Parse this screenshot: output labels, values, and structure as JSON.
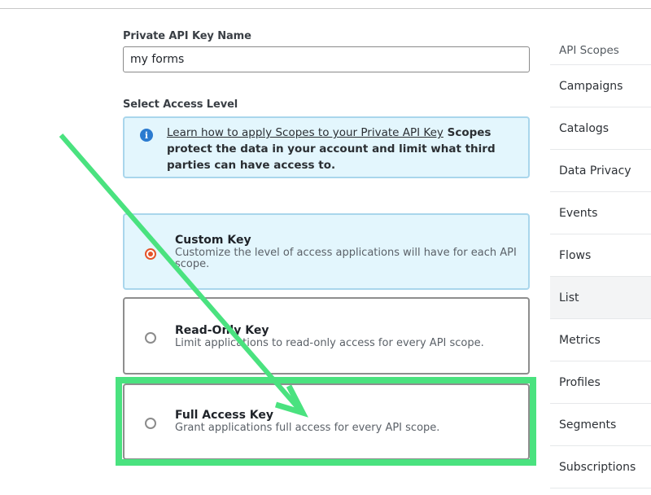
{
  "form": {
    "key_name_label": "Private API Key Name",
    "key_name_value": "my forms",
    "access_level_label": "Select Access Level"
  },
  "info": {
    "icon": "info-circle-icon",
    "link_text": "Learn how to apply Scopes to your Private API Key",
    "body_text": " Scopes protect the data in your account and limit what third parties can have access to."
  },
  "options": [
    {
      "title": "Custom Key",
      "description": "Customize the level of access applications will have for each API scope.",
      "selected": true
    },
    {
      "title": "Read-Only Key",
      "description": "Limit applications to read-only access for every API scope.",
      "selected": false
    },
    {
      "title": "Full Access Key",
      "description": "Grant applications full access for every API scope.",
      "selected": false,
      "highlighted": true
    }
  ],
  "sidebar": {
    "heading": "API Scopes",
    "items": [
      {
        "label": "Campaigns"
      },
      {
        "label": "Catalogs"
      },
      {
        "label": "Data Privacy"
      },
      {
        "label": "Events"
      },
      {
        "label": "Flows"
      },
      {
        "label": "List",
        "active": true
      },
      {
        "label": "Metrics"
      },
      {
        "label": "Profiles"
      },
      {
        "label": "Segments"
      },
      {
        "label": "Subscriptions"
      }
    ]
  },
  "annotation": {
    "color": "#4ae27f",
    "type": "arrow-and-highlight-box",
    "target": "Full Access Key"
  }
}
